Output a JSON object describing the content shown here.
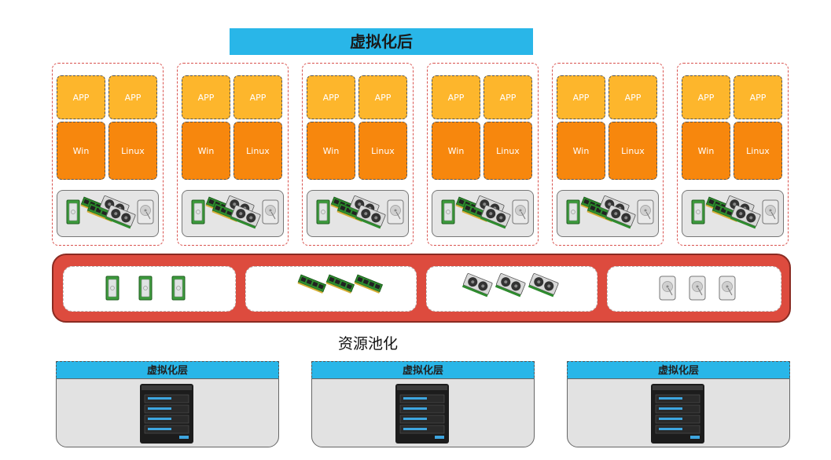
{
  "title": "虚拟化后",
  "vm_groups": [
    {
      "app1": "APP",
      "app2": "APP",
      "os1": "Win",
      "os2": "Linux"
    },
    {
      "app1": "APP",
      "app2": "APP",
      "os1": "Win",
      "os2": "Linux"
    },
    {
      "app1": "APP",
      "app2": "APP",
      "os1": "Win",
      "os2": "Linux"
    },
    {
      "app1": "APP",
      "app2": "APP",
      "os1": "Win",
      "os2": "Linux"
    },
    {
      "app1": "APP",
      "app2": "APP",
      "os1": "Win",
      "os2": "Linux"
    },
    {
      "app1": "APP",
      "app2": "APP",
      "os1": "Win",
      "os2": "Linux"
    }
  ],
  "pool": {
    "label": "资源池化",
    "slots": [
      {
        "icon": "cpu-chip-icon",
        "count": 3
      },
      {
        "icon": "memory-stick-icon",
        "count": 3
      },
      {
        "icon": "graphics-card-icon",
        "count": 3
      },
      {
        "icon": "hard-disk-icon",
        "count": 3
      }
    ]
  },
  "servers": [
    {
      "layer": "虚拟化层",
      "icon": "server-tower-icon"
    },
    {
      "layer": "虚拟化层",
      "icon": "server-tower-icon"
    },
    {
      "layer": "虚拟化层",
      "icon": "server-tower-icon"
    }
  ],
  "colors": {
    "title_bar": "#29b6e8",
    "app": "#fdb62c",
    "os": "#f7870d",
    "pool": "#dd4b3e",
    "hw_box": "#e5e5e5"
  }
}
